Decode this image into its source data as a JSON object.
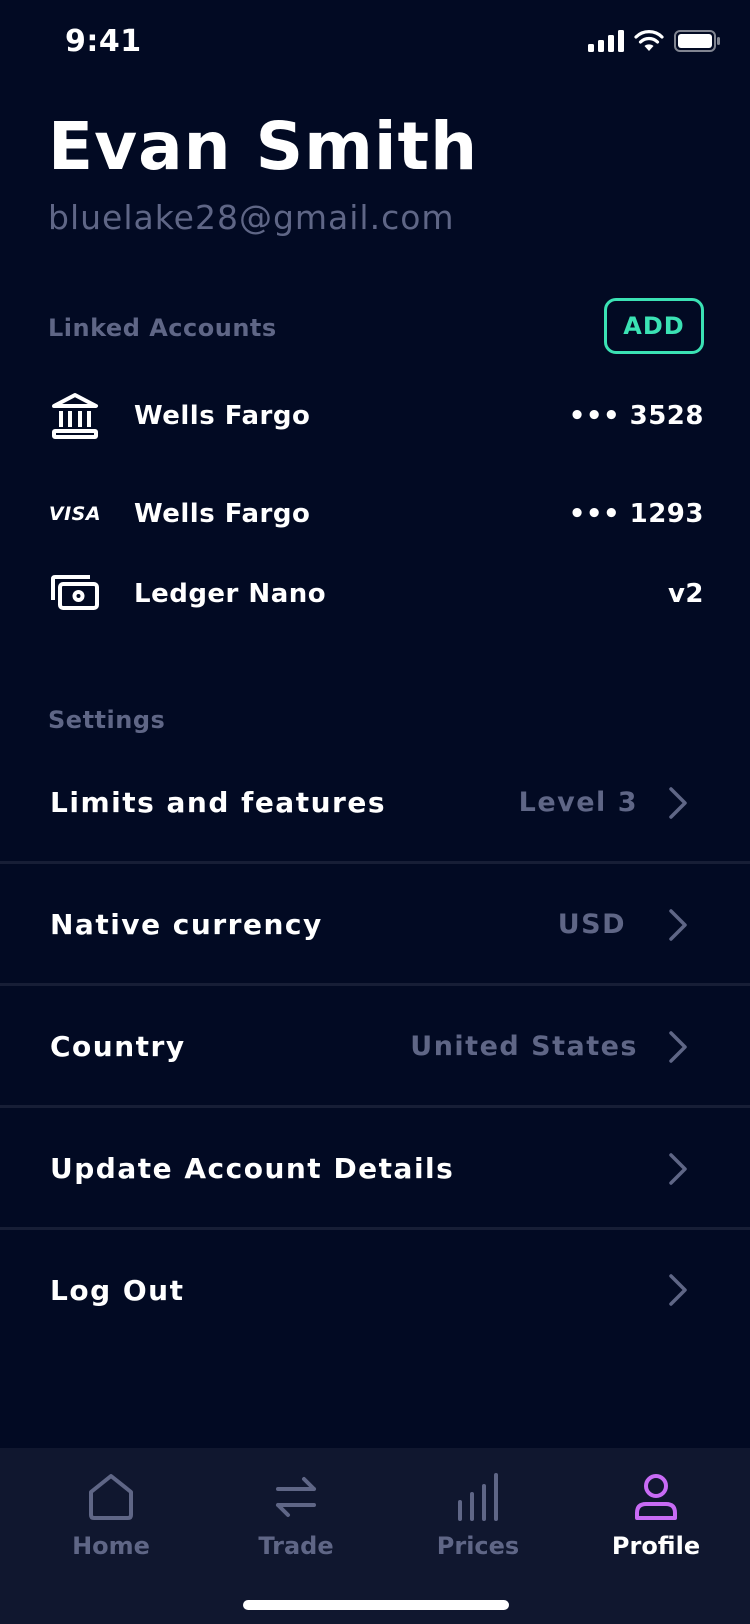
{
  "status": {
    "time": "9:41"
  },
  "profile": {
    "name": "Evan Smith",
    "email": "bluelake28@gmail.com"
  },
  "linked_accounts": {
    "label": "Linked Accounts",
    "add_label": "ADD",
    "items": [
      {
        "icon": "bank-icon",
        "name": "Wells Fargo",
        "number": "••• 3528"
      },
      {
        "icon": "visa-icon",
        "icon_text": "VISA",
        "name": "Wells Fargo",
        "number": "••• 1293"
      },
      {
        "icon": "hardware-wallet-icon",
        "name": "Ledger Nano",
        "number": "v2"
      }
    ]
  },
  "settings": {
    "label": "Settings",
    "items": [
      {
        "label": "Limits and features",
        "value": "Level 3"
      },
      {
        "label": "Native currency",
        "value": "USD"
      },
      {
        "label": "Country",
        "value": "United States"
      },
      {
        "label": "Update Account Details",
        "value": ""
      },
      {
        "label": "Log Out",
        "value": ""
      }
    ]
  },
  "tabs": [
    {
      "label": "Home",
      "icon": "home-icon",
      "active": false
    },
    {
      "label": "Trade",
      "icon": "swap-arrows-icon",
      "active": false
    },
    {
      "label": "Prices",
      "icon": "bar-chart-icon",
      "active": false
    },
    {
      "label": "Profile",
      "icon": "user-icon",
      "active": true
    }
  ],
  "colors": {
    "background": "#020a23",
    "accent": "#3be2b4",
    "muted": "#5f6686",
    "profile_active": "#c86bf5",
    "tabbar": "#10172f"
  }
}
